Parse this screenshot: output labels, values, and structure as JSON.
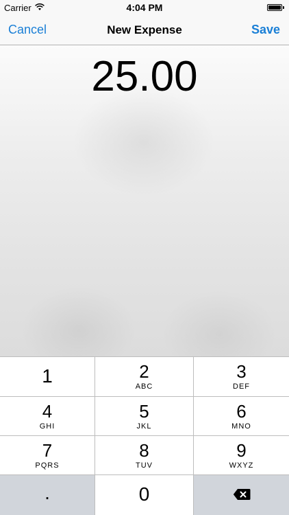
{
  "status_bar": {
    "carrier": "Carrier",
    "time": "4:04 PM"
  },
  "nav": {
    "cancel_label": "Cancel",
    "title": "New Expense",
    "save_label": "Save"
  },
  "amount": "25.00",
  "keypad": {
    "k1": {
      "digit": "1",
      "letters": ""
    },
    "k2": {
      "digit": "2",
      "letters": "ABC"
    },
    "k3": {
      "digit": "3",
      "letters": "DEF"
    },
    "k4": {
      "digit": "4",
      "letters": "GHI"
    },
    "k5": {
      "digit": "5",
      "letters": "JKL"
    },
    "k6": {
      "digit": "6",
      "letters": "MNO"
    },
    "k7": {
      "digit": "7",
      "letters": "PQRS"
    },
    "k8": {
      "digit": "8",
      "letters": "TUV"
    },
    "k9": {
      "digit": "9",
      "letters": "WXYZ"
    },
    "decimal": ".",
    "k0": {
      "digit": "0"
    },
    "delete_icon": "backspace-icon"
  },
  "colors": {
    "accent": "#1a7fd6",
    "keypad_bg": "#c9cdd1"
  }
}
